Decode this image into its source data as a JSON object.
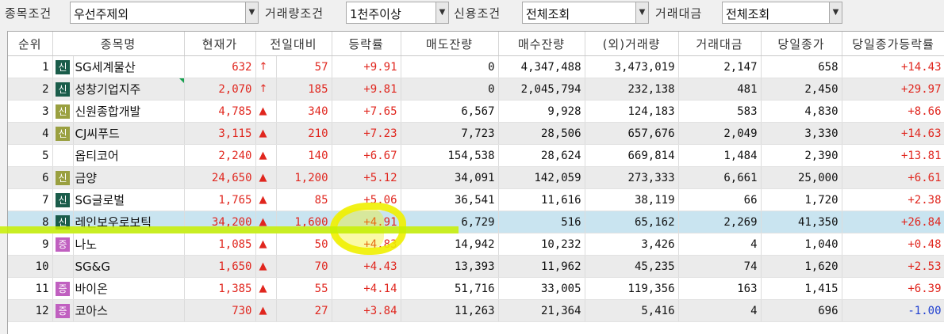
{
  "filters": [
    {
      "label": "종목조건",
      "value": "우선주제외"
    },
    {
      "label": "거래량조건",
      "value": "1천주이상"
    },
    {
      "label": "신용조건",
      "value": "전체조회"
    },
    {
      "label": "거래대금",
      "value": "전체조회"
    }
  ],
  "table": {
    "headers": [
      "순위",
      "종목명",
      "현재가",
      "전일대비",
      "등락률",
      "매도잔량",
      "매수잔량",
      "(외)거래량",
      "거래대금",
      "당일종가",
      "당일종가등락률"
    ],
    "rows": [
      {
        "rank": "1",
        "badge": "신",
        "badge_color": "#1a5c4a",
        "name": "SG세계물산",
        "price": "632",
        "arrow": "↑",
        "change": "57",
        "rate": "+9.91",
        "ask": "0",
        "bid": "4,347,488",
        "volume": "3,473,019",
        "amount": "2,147",
        "close": "658",
        "close_rate": "+14.43",
        "close_rate_color": "red"
      },
      {
        "rank": "2",
        "badge": "신",
        "badge_color": "#1a5c4a",
        "name": "성창기업지주",
        "price": "2,070",
        "arrow": "↑",
        "change": "185",
        "rate": "+9.81",
        "ask": "0",
        "bid": "2,045,794",
        "volume": "232,138",
        "amount": "481",
        "close": "2,450",
        "close_rate": "+29.97",
        "close_rate_color": "red"
      },
      {
        "rank": "3",
        "badge": "신",
        "badge_color": "#9aa040",
        "name": "신원종합개발",
        "price": "4,785",
        "arrow": "▲",
        "change": "340",
        "rate": "+7.65",
        "ask": "6,567",
        "bid": "9,928",
        "volume": "124,183",
        "amount": "583",
        "close": "4,830",
        "close_rate": "+8.66",
        "close_rate_color": "red"
      },
      {
        "rank": "4",
        "badge": "신",
        "badge_color": "#9aa040",
        "name": "CJ씨푸드",
        "price": "3,115",
        "arrow": "▲",
        "change": "210",
        "rate": "+7.23",
        "ask": "7,723",
        "bid": "28,506",
        "volume": "657,676",
        "amount": "2,049",
        "close": "3,330",
        "close_rate": "+14.63",
        "close_rate_color": "red"
      },
      {
        "rank": "5",
        "badge": "",
        "badge_color": "",
        "name": "옵티코어",
        "price": "2,240",
        "arrow": "▲",
        "change": "140",
        "rate": "+6.67",
        "ask": "154,538",
        "bid": "28,624",
        "volume": "669,814",
        "amount": "1,484",
        "close": "2,390",
        "close_rate": "+13.81",
        "close_rate_color": "red"
      },
      {
        "rank": "6",
        "badge": "신",
        "badge_color": "#9aa040",
        "name": "금양",
        "price": "24,650",
        "arrow": "▲",
        "change": "1,200",
        "rate": "+5.12",
        "ask": "34,091",
        "bid": "142,059",
        "volume": "273,333",
        "amount": "6,661",
        "close": "25,000",
        "close_rate": "+6.61",
        "close_rate_color": "red"
      },
      {
        "rank": "7",
        "badge": "신",
        "badge_color": "#1a5c4a",
        "name": "SG글로벌",
        "price": "1,765",
        "arrow": "▲",
        "change": "85",
        "rate": "+5.06",
        "ask": "36,541",
        "bid": "11,616",
        "volume": "38,119",
        "amount": "66",
        "close": "1,720",
        "close_rate": "+2.38",
        "close_rate_color": "red"
      },
      {
        "rank": "8",
        "badge": "신",
        "badge_color": "#1a5c4a",
        "name": "레인보우로보틱",
        "price": "34,200",
        "arrow": "▲",
        "change": "1,600",
        "rate": "+4.91",
        "ask": "6,729",
        "bid": "516",
        "volume": "65,162",
        "amount": "2,269",
        "close": "41,350",
        "close_rate": "+26.84",
        "close_rate_color": "red"
      },
      {
        "rank": "9",
        "badge": "증",
        "badge_color": "#c060c0",
        "name": "나노",
        "price": "1,085",
        "arrow": "▲",
        "change": "50",
        "rate": "+4.83",
        "ask": "14,942",
        "bid": "10,232",
        "volume": "3,426",
        "amount": "4",
        "close": "1,040",
        "close_rate": "+0.48",
        "close_rate_color": "red"
      },
      {
        "rank": "10",
        "badge": "",
        "badge_color": "",
        "name": "SG&G",
        "price": "1,650",
        "arrow": "▲",
        "change": "70",
        "rate": "+4.43",
        "ask": "13,393",
        "bid": "11,962",
        "volume": "45,235",
        "amount": "74",
        "close": "1,620",
        "close_rate": "+2.53",
        "close_rate_color": "red"
      },
      {
        "rank": "11",
        "badge": "증",
        "badge_color": "#c060c0",
        "name": "바이온",
        "price": "1,385",
        "arrow": "▲",
        "change": "55",
        "rate": "+4.14",
        "ask": "51,716",
        "bid": "33,005",
        "volume": "119,356",
        "amount": "163",
        "close": "1,415",
        "close_rate": "+6.39",
        "close_rate_color": "red"
      },
      {
        "rank": "12",
        "badge": "증",
        "badge_color": "#c060c0",
        "name": "코아스",
        "price": "730",
        "arrow": "▲",
        "change": "27",
        "rate": "+3.84",
        "ask": "11,263",
        "bid": "21,364",
        "volume": "5,416",
        "amount": "4",
        "close": "696",
        "close_rate": "-1.00",
        "close_rate_color": "blue"
      }
    ]
  },
  "colors": {
    "up": "#e0261e",
    "down": "#2040d0",
    "selected_row": "#c9e4f0",
    "highlighter_yellow": "#f0f000",
    "highlighter_green": "#c8f000"
  }
}
